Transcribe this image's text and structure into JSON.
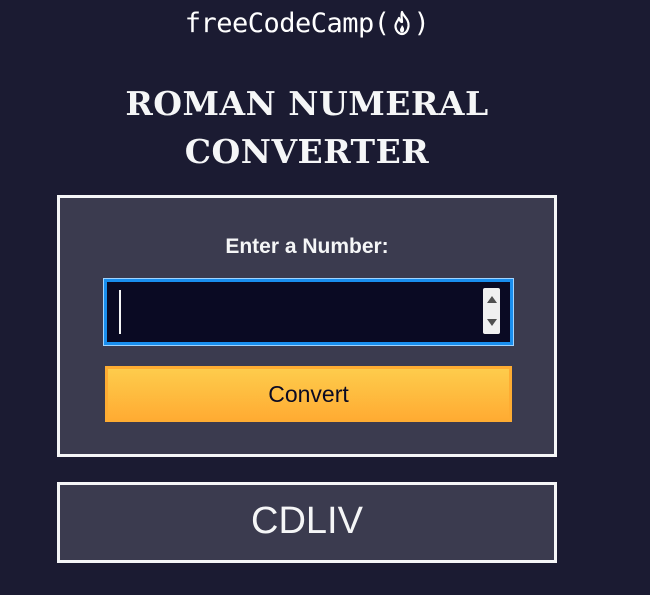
{
  "header": {
    "logo_text_before": "freeCodeCamp(",
    "logo_text_after": ")",
    "logo_icon": "flame-icon"
  },
  "main": {
    "title_line1": "ROMAN NUMERAL",
    "title_line2": "CONVERTER"
  },
  "form": {
    "label": "Enter a Number:",
    "input_value": "",
    "spinner_up_icon": "caret-up-icon",
    "spinner_down_icon": "caret-down-icon",
    "convert_label": "Convert"
  },
  "output": {
    "result": "CDLIV"
  },
  "colors": {
    "background": "#1b1b32",
    "panel": "#3b3b4f",
    "input_bg": "#0a0a23",
    "focus_border": "#198eee",
    "button_top": "#fecc4c",
    "button_bottom": "#ffac33",
    "text": "#f5f6f7"
  }
}
